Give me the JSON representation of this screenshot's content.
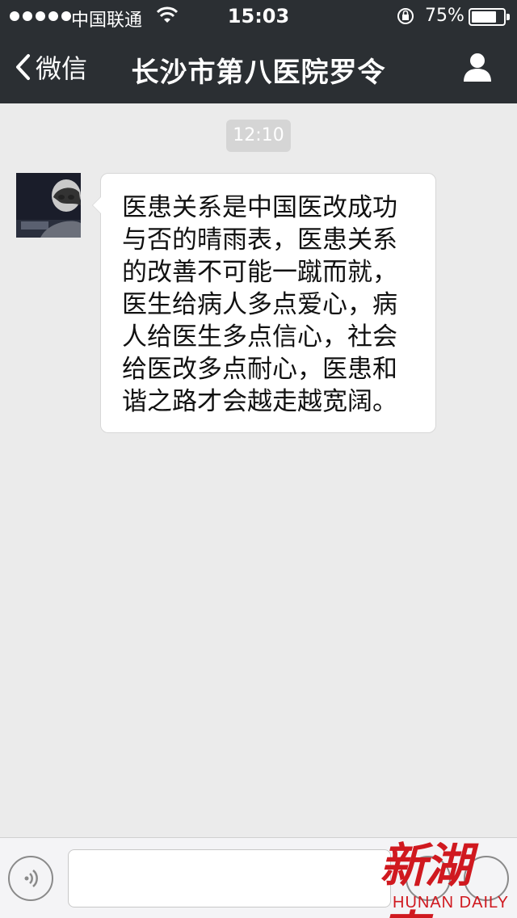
{
  "status_bar": {
    "carrier": "中国联通",
    "time": "15:03",
    "battery_percent": "75%",
    "battery_level": 0.75
  },
  "nav": {
    "back_label": "微信",
    "title": "长沙市第八医院罗令"
  },
  "chat": {
    "timestamp": "12:10",
    "messages": [
      {
        "sender": "other",
        "text": "医患关系是中国医改成功与否的晴雨表，医患关系的改善不可能一蹴而就，医生给病人多点爱心，病人给医生多点信心，社会给医改多点耐心，医患和谐之路才会越走越宽阔。"
      }
    ]
  },
  "input_bar": {
    "value": ""
  },
  "watermark": {
    "cn": "新湖南",
    "en": "HUNAN DAILY",
    "color": "#d0191f"
  },
  "colors": {
    "nav_bg": "#2b2f33",
    "chat_bg": "#ebebeb",
    "bubble_bg": "#ffffff",
    "time_badge_bg": "#d5d5d5"
  }
}
